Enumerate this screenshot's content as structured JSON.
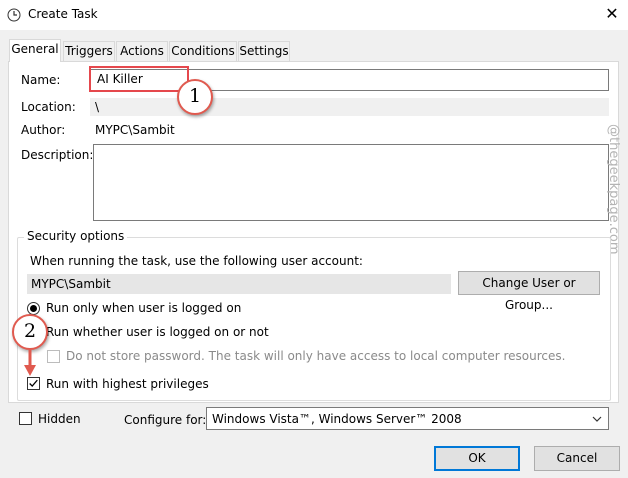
{
  "window": {
    "title": "Create Task",
    "close_glyph": "✕"
  },
  "tabs": [
    "General",
    "Triggers",
    "Actions",
    "Conditions",
    "Settings"
  ],
  "general": {
    "name_label": "Name:",
    "name_value": "AI Killer",
    "location_label": "Location:",
    "location_value": "\\",
    "author_label": "Author:",
    "author_value": "MYPC\\Sambit",
    "description_label": "Description:",
    "description_value": ""
  },
  "security": {
    "title": "Security options",
    "account_prompt": "When running the task, use the following user account:",
    "account_value": "MYPC\\Sambit",
    "change_button": "Change User or Group...",
    "radio_logged_on": "Run only when user is logged on",
    "radio_any": "Run whether user is logged on or not",
    "no_store_password": "Do not store password.  The task will only have access to local computer resources.",
    "highest_privileges": "Run with highest privileges",
    "selected_radio": "logged_on",
    "highest_checked": true
  },
  "bottom": {
    "hidden_label": "Hidden",
    "configure_label": "Configure for:",
    "configure_value": "Windows Vista™, Windows Server™ 2008",
    "ok": "OK",
    "cancel": "Cancel"
  },
  "annotations": {
    "badge1": "1",
    "badge2": "2",
    "accent_color": "#e05a4f"
  },
  "watermark": "@thegeekpage.com",
  "colors": {
    "focus_blue": "#0078d7",
    "highlight_red": "#e5484d"
  }
}
